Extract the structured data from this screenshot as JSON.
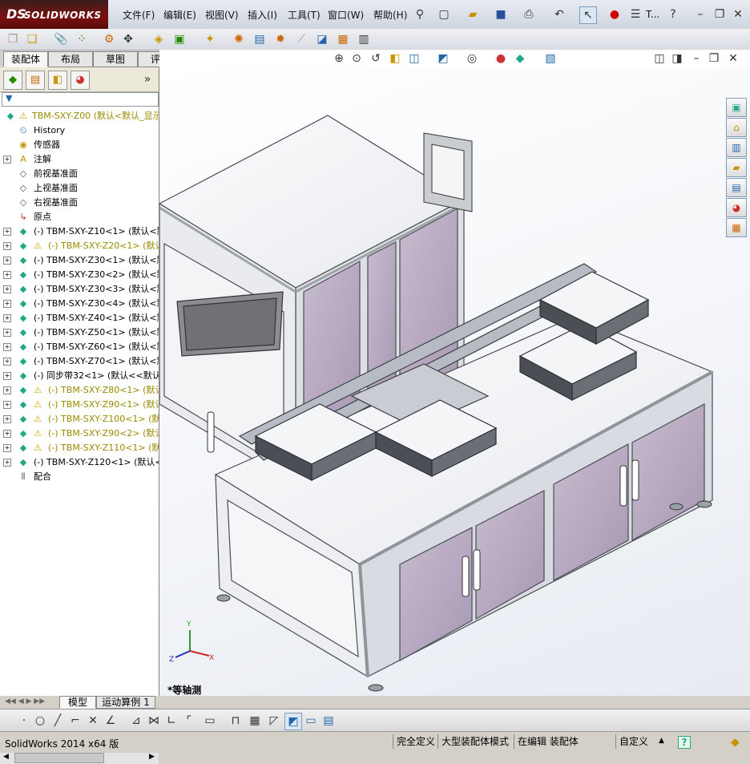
{
  "app": {
    "logo_ds": "DS",
    "logo_name": "SOLIDWORKS"
  },
  "menu": [
    "文件(F)",
    "编辑(E)",
    "视图(V)",
    "插入(I)",
    "工具(T)",
    "窗口(W)",
    "帮助(H)"
  ],
  "title_trunc": "T...",
  "tabs": [
    "装配体",
    "布局",
    "草图",
    "评估"
  ],
  "tree": {
    "root": "TBM-SXY-Z00  (默认<默认_显示",
    "items": [
      {
        "label": "History",
        "icon": "history-icon",
        "warn": false,
        "olive": false,
        "exp": false
      },
      {
        "label": "传感器",
        "icon": "sensor-icon",
        "warn": false,
        "olive": false,
        "exp": false
      },
      {
        "label": "注解",
        "icon": "annotation-icon",
        "warn": false,
        "olive": false,
        "exp": true
      },
      {
        "label": "前视基准面",
        "icon": "plane-icon",
        "warn": false,
        "olive": false,
        "exp": false
      },
      {
        "label": "上视基准面",
        "icon": "plane-icon",
        "warn": false,
        "olive": false,
        "exp": false
      },
      {
        "label": "右视基准面",
        "icon": "plane-icon",
        "warn": false,
        "olive": false,
        "exp": false
      },
      {
        "label": "原点",
        "icon": "origin-icon",
        "warn": false,
        "olive": false,
        "exp": false
      },
      {
        "label": "(-) TBM-SXY-Z10<1> (默认<默",
        "icon": "assembly-icon",
        "warn": false,
        "olive": false,
        "exp": true
      },
      {
        "label": "(-) TBM-SXY-Z20<1> (默认<",
        "icon": "assembly-icon",
        "warn": true,
        "olive": true,
        "exp": true
      },
      {
        "label": "(-) TBM-SXY-Z30<1> (默认<默",
        "icon": "assembly-icon",
        "warn": false,
        "olive": false,
        "exp": true
      },
      {
        "label": "(-) TBM-SXY-Z30<2> (默认<默",
        "icon": "assembly-icon",
        "warn": false,
        "olive": false,
        "exp": true
      },
      {
        "label": "(-) TBM-SXY-Z30<3> (默认<默",
        "icon": "assembly-icon",
        "warn": false,
        "olive": false,
        "exp": true
      },
      {
        "label": "(-) TBM-SXY-Z30<4> (默认<默",
        "icon": "assembly-icon",
        "warn": false,
        "olive": false,
        "exp": true
      },
      {
        "label": "(-) TBM-SXY-Z40<1> (默认<默",
        "icon": "assembly-icon",
        "warn": false,
        "olive": false,
        "exp": true
      },
      {
        "label": "(-) TBM-SXY-Z50<1> (默认<默",
        "icon": "assembly-icon",
        "warn": false,
        "olive": false,
        "exp": true
      },
      {
        "label": "(-) TBM-SXY-Z60<1> (默认<默",
        "icon": "assembly-icon",
        "warn": false,
        "olive": false,
        "exp": true
      },
      {
        "label": "(-) TBM-SXY-Z70<1> (默认<默",
        "icon": "assembly-icon",
        "warn": false,
        "olive": false,
        "exp": true
      },
      {
        "label": "(-) 同步带32<1> (默认<<默认",
        "icon": "assembly-icon",
        "warn": false,
        "olive": false,
        "exp": true
      },
      {
        "label": "(-) TBM-SXY-Z80<1> (默认<",
        "icon": "assembly-icon",
        "warn": true,
        "olive": true,
        "exp": true
      },
      {
        "label": "(-) TBM-SXY-Z90<1> (默认<",
        "icon": "assembly-icon",
        "warn": true,
        "olive": true,
        "exp": true
      },
      {
        "label": "(-) TBM-SXY-Z100<1> (默认",
        "icon": "assembly-icon",
        "warn": true,
        "olive": true,
        "exp": true
      },
      {
        "label": "(-) TBM-SXY-Z90<2> (默认<",
        "icon": "assembly-icon",
        "warn": true,
        "olive": true,
        "exp": true
      },
      {
        "label": "(-) TBM-SXY-Z110<1> (默认",
        "icon": "assembly-icon",
        "warn": true,
        "olive": true,
        "exp": true
      },
      {
        "label": "(-) TBM-SXY-Z120<1> (默认<默",
        "icon": "assembly-icon",
        "warn": false,
        "olive": false,
        "exp": true
      },
      {
        "label": "配合",
        "icon": "mates-icon",
        "warn": false,
        "olive": false,
        "exp": false
      }
    ]
  },
  "bottom_tabs": [
    "模型",
    "运动算例 1"
  ],
  "view_label": "*等轴测",
  "triad": {
    "x": "X",
    "y": "Y",
    "z": "Z"
  },
  "status": {
    "app_version": "SolidWorks 2014 x64 版",
    "fully_defined": "完全定义",
    "large_assembly": "大型装配体模式",
    "editing": "在编辑 装配体",
    "custom": "自定义",
    "help": "?"
  },
  "colors": {
    "panel_purple": "#bdb0c6",
    "frame": "#a9adb3",
    "accent_red": "#7a1010"
  }
}
